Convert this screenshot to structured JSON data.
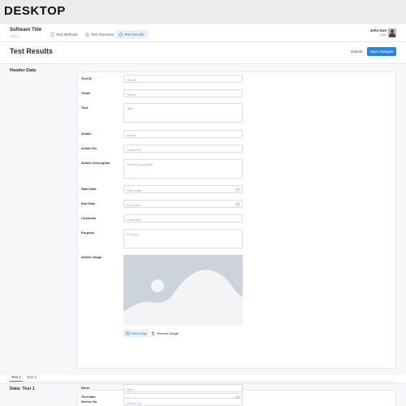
{
  "header_label": "DESKTOP",
  "app": {
    "title": "Software Title",
    "version": "v 0.1.1"
  },
  "nav": {
    "tabs": [
      {
        "label": "Test Methods",
        "icon": "clipboard-icon"
      },
      {
        "label": "Test Overview",
        "icon": "document-icon"
      },
      {
        "label": "Test Results",
        "icon": "check-doc-icon",
        "active": true
      }
    ]
  },
  "user": {
    "name": "John Doe",
    "role": "User"
  },
  "page": {
    "title": "Test Results",
    "cancel_label": "Cancel",
    "save_label": "Save changes"
  },
  "header_data": {
    "section_title": "Header Data",
    "fields": {
      "test_id": {
        "label": "Test ID",
        "placeholder": "Test ID"
      },
      "tester": {
        "label": "Tester",
        "placeholder": "Tester"
      },
      "test": {
        "label": "Test",
        "placeholder": "Test"
      },
      "article": {
        "label": "Article",
        "placeholder": "Article"
      },
      "article_no": {
        "label": "Article No.",
        "placeholder": "Article No."
      },
      "article_description": {
        "label": "Article Description",
        "placeholder": "Article Description"
      },
      "start_date": {
        "label": "Start Date",
        "placeholder": "Start Date"
      },
      "end_date": {
        "label": "End Date",
        "placeholder": "End Date"
      },
      "customer": {
        "label": "Customer",
        "placeholder": "Customer"
      },
      "purpose": {
        "label": "Purpose",
        "placeholder": "Purpose"
      },
      "article_image": {
        "label": "Article image"
      }
    },
    "image_buttons": {
      "add": "Add image",
      "remove": "Remove image"
    }
  },
  "test_tabs": [
    {
      "label": "Test 1",
      "active": true
    },
    {
      "label": "Test 2"
    }
  ],
  "data_section": {
    "title": "Data: Test 1",
    "fields": {
      "test_date": {
        "label": "Test Date",
        "placeholder": "Test Date"
      },
      "norm": {
        "label": "Norm",
        "placeholder": "Norm"
      },
      "device_no": {
        "label": "Device No.",
        "placeholder": "Device No."
      }
    }
  },
  "colors": {
    "accent": "#2b86d9",
    "active_tab_bg": "#e8f2fb",
    "placeholder_image": "#cdd3da"
  }
}
